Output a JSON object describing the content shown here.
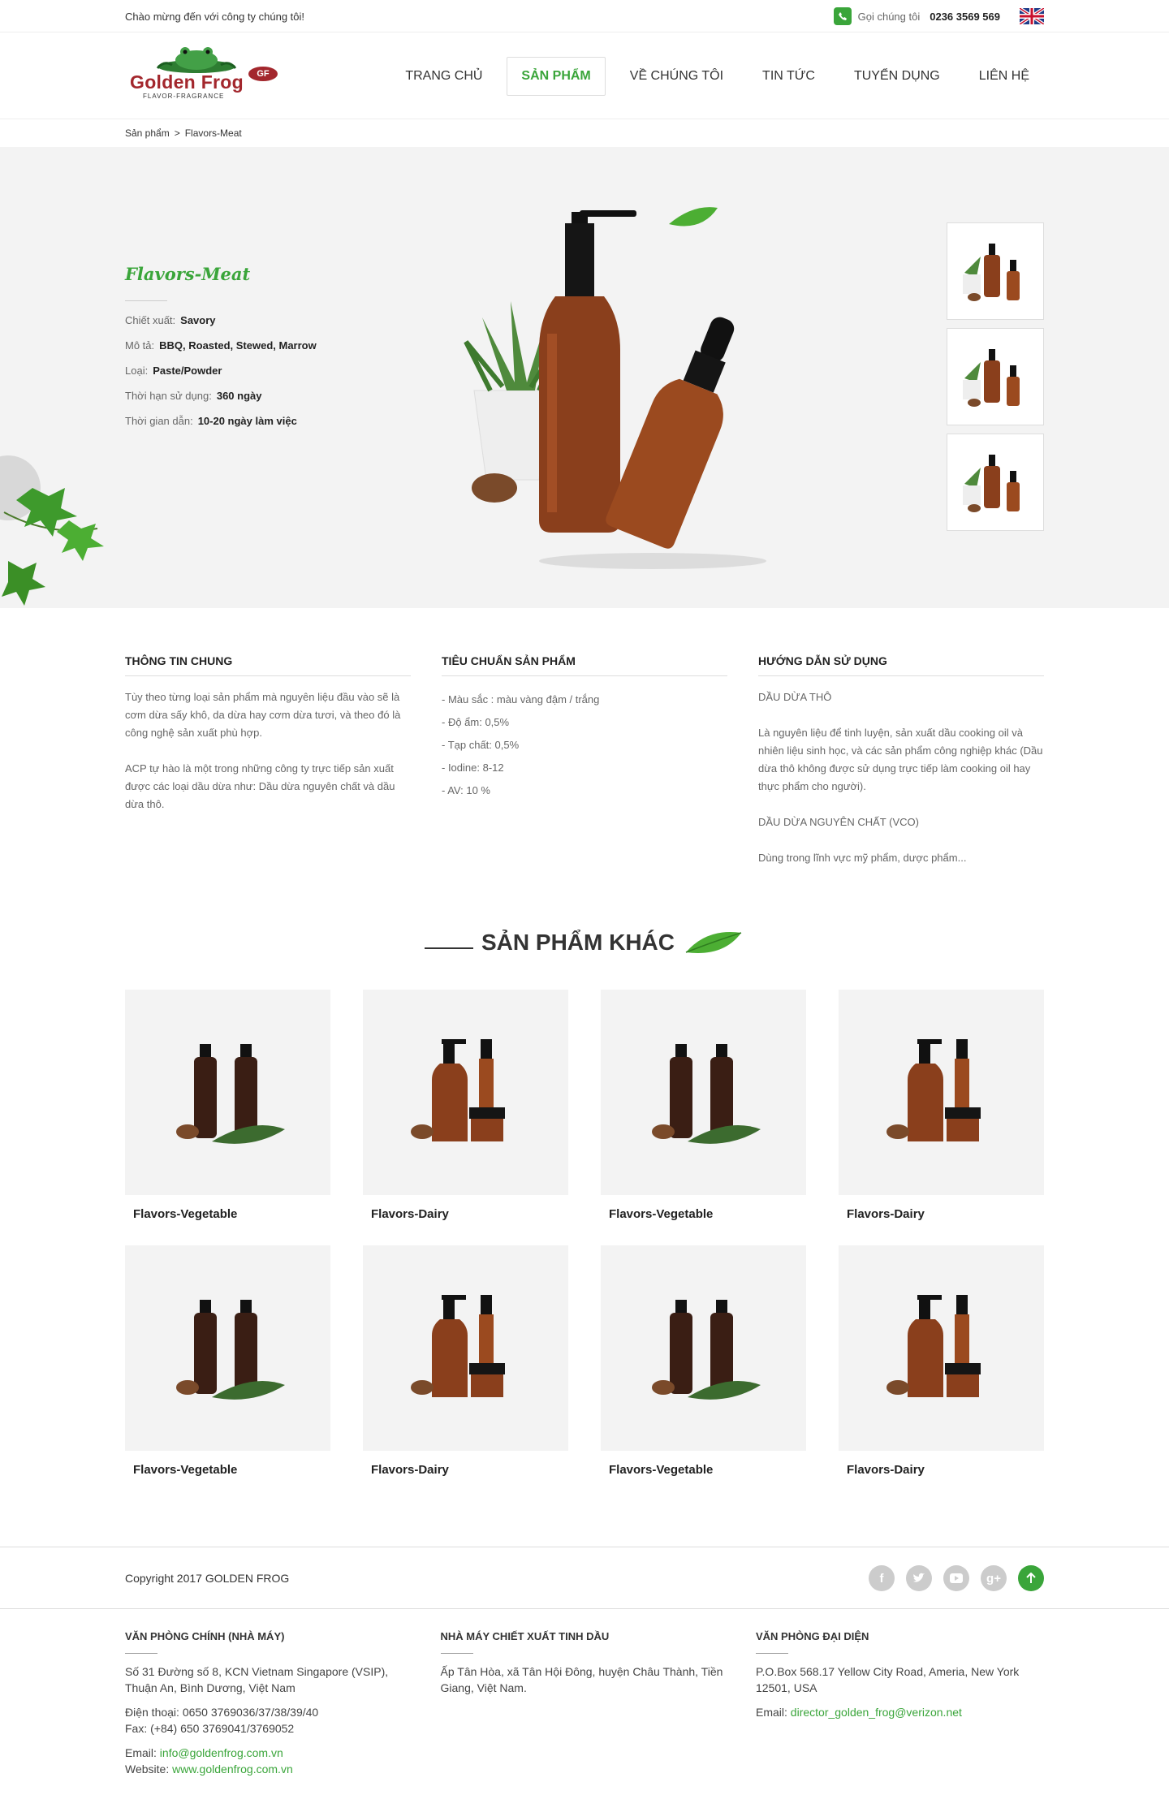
{
  "topbar": {
    "welcome": "Chào mừng đến với công ty chúng tôi!",
    "call_label": "Gọi chúng tôi",
    "phone": "0236 3569 569"
  },
  "logo": {
    "name": "Golden Frog",
    "tagline": "FLAVOR-FRAGRANCE",
    "badge": "GF"
  },
  "nav": [
    "TRANG CHỦ",
    "SẢN PHẨM",
    "VỀ CHÚNG TÔI",
    "TIN TỨC",
    "TUYỂN DỤNG",
    "LIÊN HỆ"
  ],
  "breadcrumb": {
    "parent": "Sản phẩm",
    "sep": ">",
    "current": "Flavors-Meat"
  },
  "product": {
    "title": "Flavors-Meat",
    "specs": [
      {
        "label": "Chiết xuất:",
        "value": "Savory"
      },
      {
        "label": "Mô tả:",
        "value": "BBQ, Roasted, Stewed, Marrow"
      },
      {
        "label": "Loại:",
        "value": "Paste/Powder"
      },
      {
        "label": "Thời hạn sử dụng:",
        "value": "360 ngày"
      },
      {
        "label": "Thời gian dẫn:",
        "value": "10-20 ngày làm việc"
      }
    ]
  },
  "info": {
    "general": {
      "title": "THÔNG TIN CHUNG",
      "p1": "Tùy theo từng loại sản phẩm mà nguyên liệu đầu vào sẽ là cơm dừa sấy khô, da dừa hay cơm dừa tươi, và theo đó là công nghệ sản xuất phù hợp.",
      "p2": "ACP tự hào là một trong những công ty trực tiếp sản xuất được các loại dầu dừa như: Dầu dừa nguyên chất và dầu dừa thô."
    },
    "standard": {
      "title": "TIÊU CHUẨN SẢN PHẨM",
      "items": [
        "- Màu sắc : màu vàng đậm / trắng",
        "- Độ ẩm: 0,5%",
        "- Tạp chất: 0,5%",
        "- Iodine: 8-12",
        "- AV: 10 %"
      ]
    },
    "usage": {
      "title": "HƯỚNG DẪN SỬ DỤNG",
      "p1": "DẦU  DỪA THÔ",
      "p2": "Là nguyên liệu  để tinh luyện, sản xuất dầu cooking oil và nhiên liệu sinh học, và các sản phẩm công nghiệp khác (Dầu dừa thô không được sử dụng trực tiếp làm cooking oil hay thực phẩm cho người).",
      "p3": "DẦU DỪA NGUYÊN CHẤT (VCO)",
      "p4": "Dùng trong lĩnh vực mỹ phẩm, dược phẩm..."
    }
  },
  "others": {
    "heading": "SẢN PHẨM KHÁC",
    "items": [
      "Flavors-Vegetable",
      "Flavors-Dairy",
      "Flavors-Vegetable",
      "Flavors-Dairy",
      "Flavors-Vegetable",
      "Flavors-Dairy",
      "Flavors-Vegetable",
      "Flavors-Dairy"
    ]
  },
  "footer": {
    "copyright": "Copyright 2017 GOLDEN FROG",
    "social": [
      "facebook-icon",
      "twitter-icon",
      "youtube-icon",
      "google-plus-icon"
    ],
    "col1": {
      "title": "VĂN PHÒNG CHÍNH (NHÀ MÁY)",
      "address": "Số 31 Đường số 8, KCN Vietnam Singapore (VSIP), Thuận An, Bình Dương, Việt Nam",
      "phone": "Điện thoại: 0650 3769036/37/38/39/40",
      "fax": "Fax: (+84) 650 3769041/3769052",
      "email_label": "Email:",
      "email": "info@goldenfrog.com.vn",
      "web_label": "Website:",
      "web": "www.goldenfrog.com.vn"
    },
    "col2": {
      "title": "NHÀ MÁY CHIẾT XUẤT TINH DẦU",
      "address": "Ấp Tân Hòa, xã Tân Hội Đông, huyện Châu Thành, Tiền Giang, Việt Nam."
    },
    "col3": {
      "title": "VĂN PHÒNG ĐẠI DIỆN",
      "address": "P.O.Box 568.17 Yellow City Road, Ameria, New York 12501, USA",
      "email_label": "Email:",
      "email": "director_golden_frog@verizon.net"
    }
  },
  "colors": {
    "accent": "#3aa53a",
    "brand": "#a3272d",
    "hero_bg": "#f3f3f3"
  }
}
